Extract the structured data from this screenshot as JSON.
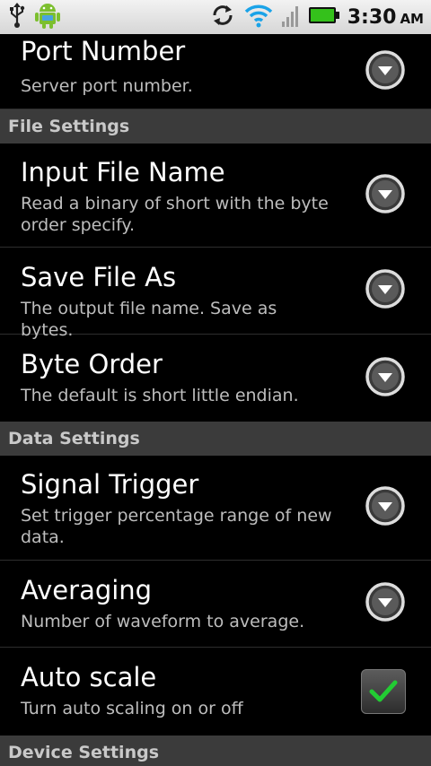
{
  "status_bar": {
    "time": "3:30",
    "ampm": "AM",
    "icons": [
      "usb-icon",
      "android-icon",
      "sync-icon",
      "wifi-icon",
      "signal-icon",
      "battery-icon"
    ]
  },
  "items_top": [
    {
      "title": "Port Number",
      "summary": "Server port number."
    }
  ],
  "sections": [
    {
      "header": "File Settings",
      "items": [
        {
          "title": "Input File Name",
          "summary": "Read a binary of short with the byte order specify."
        },
        {
          "title": "Save File As",
          "summary": "The output file name. Save as bytes."
        },
        {
          "title": "Byte Order",
          "summary": "The default is short little endian."
        }
      ]
    },
    {
      "header": "Data Settings",
      "items": [
        {
          "title": "Signal Trigger",
          "summary": "Set trigger percentage range of new data."
        },
        {
          "title": "Averaging",
          "summary": "Number of waveform to average."
        },
        {
          "title": "Auto scale",
          "summary": "Turn auto scaling on or off",
          "checked": true
        }
      ]
    },
    {
      "header": "Device Settings",
      "items": []
    }
  ],
  "colors": {
    "check": "#22cc33",
    "header_bg": "#3b3b3b"
  }
}
